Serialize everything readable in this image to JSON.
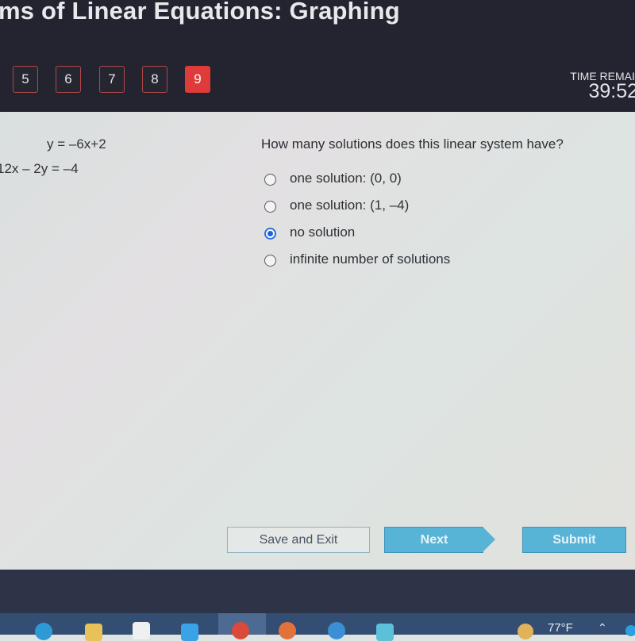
{
  "header": {
    "title": "ms of Linear Equations: Graphing",
    "question_nav": [
      {
        "label": "5",
        "active": false
      },
      {
        "label": "6",
        "active": false
      },
      {
        "label": "7",
        "active": false
      },
      {
        "label": "8",
        "active": false
      },
      {
        "label": "9",
        "active": true
      }
    ],
    "time_label": "TIME REMAIN",
    "time_value": "39:52"
  },
  "problem": {
    "equation_1": "y = –6x+2",
    "equation_2": "12x – 2y = –4",
    "question": "How many solutions does this linear system have?",
    "options": [
      {
        "label": "one solution: (0, 0)",
        "selected": false
      },
      {
        "label": "one solution: (1, –4)",
        "selected": false
      },
      {
        "label": "no solution",
        "selected": true
      },
      {
        "label": "infinite number of solutions",
        "selected": false
      }
    ]
  },
  "buttons": {
    "save_exit": "Save and Exit",
    "next": "Next",
    "submit": "Submit"
  },
  "taskbar": {
    "icons": [
      "edge-icon",
      "file-explorer-icon",
      "store-icon",
      "mail-icon",
      "chrome-icon",
      "firefox-icon",
      "internet-explorer-icon",
      "app-icon"
    ],
    "temperature": "77°F"
  },
  "colors": {
    "active_question": "#e03b3b",
    "primary_button": "#58b4d6",
    "radio_selected": "#1f63d6"
  }
}
